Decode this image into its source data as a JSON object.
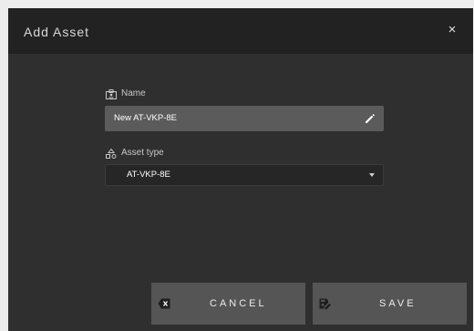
{
  "dialog": {
    "title": "Add Asset",
    "close_glyph": "×"
  },
  "name_field": {
    "label": "Name",
    "icon": "badge-icon",
    "value": "New AT-VKP-8E",
    "edit_icon": "pencil-icon"
  },
  "asset_type_field": {
    "label": "Asset type",
    "icon": "shapes-icon",
    "selected": "AT-VKP-8E",
    "dropdown_icon": "caret-down-icon"
  },
  "buttons": {
    "cancel_label": "CANCEL",
    "cancel_icon": "backspace-icon",
    "save_label": "SAVE",
    "save_icon": "save-edit-icon"
  },
  "colors": {
    "header_bg": "#222222",
    "dialog_bg": "#2f2f2f",
    "input_bg": "#5b5b5b",
    "button_bg": "#555555",
    "page_bg": "#ececec"
  }
}
